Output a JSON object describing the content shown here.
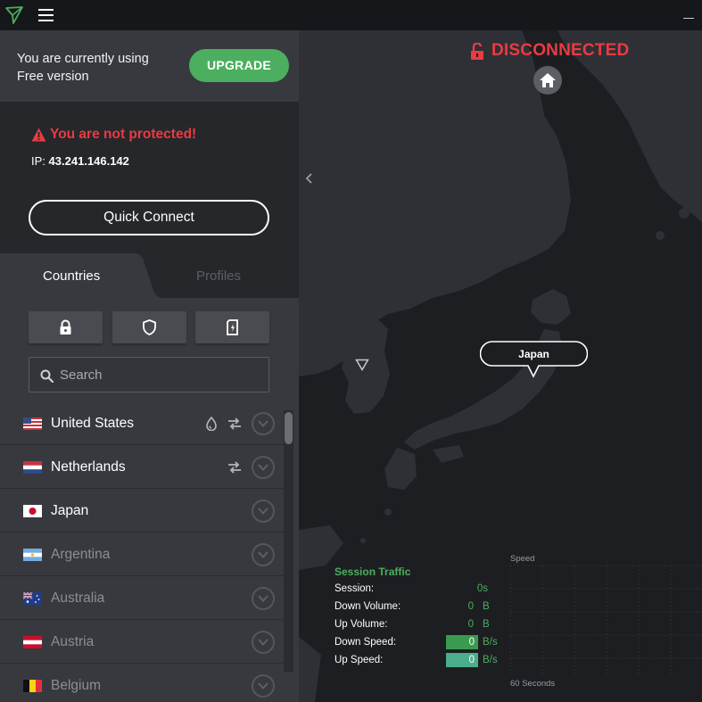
{
  "window": {
    "colors": {
      "accent_green": "#4caf5f",
      "alert_red": "#ea3b41",
      "panel": "#38393e",
      "panel_dark": "#26272b",
      "map_bg": "#1d1e22",
      "land": "#2e3036"
    }
  },
  "upgrade": {
    "line1": "You are currently using",
    "line2": "Free version",
    "button_label": "UPGRADE"
  },
  "status": {
    "warning": "You are not protected!",
    "ip_label": "IP:",
    "ip_value": "43.241.146.142",
    "quick_connect_label": "Quick Connect"
  },
  "tabs": [
    {
      "label": "Countries",
      "active": true
    },
    {
      "label": "Profiles",
      "active": false
    }
  ],
  "filters": [
    {
      "icon": "lock-icon"
    },
    {
      "icon": "shield-icon"
    },
    {
      "icon": "sim-card-icon"
    }
  ],
  "search": {
    "placeholder": "Search"
  },
  "countries": [
    {
      "name": "United States",
      "available": true,
      "features": [
        "p2p-icon",
        "secure-core-icon"
      ]
    },
    {
      "name": "Netherlands",
      "available": true,
      "features": [
        "secure-core-icon"
      ]
    },
    {
      "name": "Japan",
      "available": true,
      "features": []
    },
    {
      "name": "Argentina",
      "available": false,
      "features": []
    },
    {
      "name": "Australia",
      "available": false,
      "features": []
    },
    {
      "name": "Austria",
      "available": false,
      "features": []
    },
    {
      "name": "Belgium",
      "available": false,
      "features": []
    }
  ],
  "map": {
    "connection_status": "DISCONNECTED",
    "pin_label": "Japan"
  },
  "session_traffic": {
    "title": "Session Traffic",
    "rows": [
      {
        "label": "Session:",
        "value": "0s",
        "unit": ""
      },
      {
        "label": "Down Volume:",
        "value": "0",
        "unit": "B"
      },
      {
        "label": "Up Volume:",
        "value": "0",
        "unit": "B"
      },
      {
        "label": "Down Speed:",
        "value": "0",
        "unit": "B/s"
      },
      {
        "label": "Up Speed:",
        "value": "0",
        "unit": "B/s"
      }
    ]
  },
  "speed_graph": {
    "title": "Speed",
    "footer": "60 Seconds"
  }
}
